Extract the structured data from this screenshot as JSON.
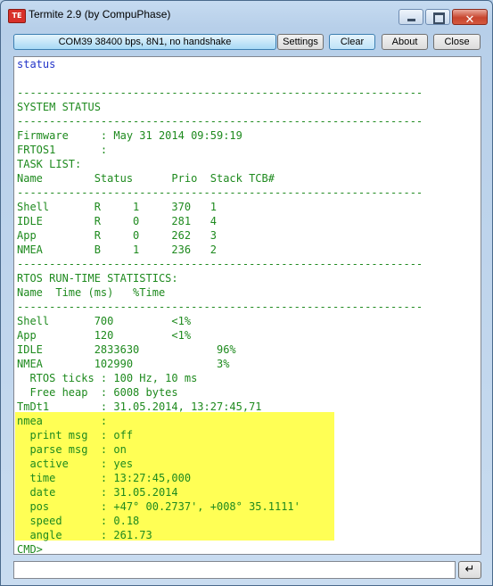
{
  "window": {
    "title": "Termite 2.9 (by CompuPhase)",
    "app_icon_text": "TE",
    "controls": {
      "minimize": "minimize",
      "maximize": "maximize",
      "close": "✕"
    }
  },
  "toolbar": {
    "connection_status": "COM39 38400 bps, 8N1, no handshake",
    "settings_label": "Settings",
    "clear_label": "Clear",
    "about_label": "About",
    "close_label": "Close"
  },
  "terminal": {
    "lines": [
      {
        "text": "status",
        "kind": "cmd"
      },
      {
        "text": "",
        "kind": "out"
      },
      {
        "text": "---------------------------------------------------------------",
        "kind": "out"
      },
      {
        "text": "SYSTEM STATUS",
        "kind": "out"
      },
      {
        "text": "---------------------------------------------------------------",
        "kind": "out"
      },
      {
        "text": "Firmware     : May 31 2014 09:59:19",
        "kind": "out"
      },
      {
        "text": "FRTOS1       :",
        "kind": "out"
      },
      {
        "text": "TASK LIST:",
        "kind": "out"
      },
      {
        "text": "Name        Status      Prio  Stack TCB#",
        "kind": "out"
      },
      {
        "text": "---------------------------------------------------------------",
        "kind": "out"
      },
      {
        "text": "Shell       R     1     370   1",
        "kind": "out"
      },
      {
        "text": "IDLE        R     0     281   4",
        "kind": "out"
      },
      {
        "text": "App         R     0     262   3",
        "kind": "out"
      },
      {
        "text": "NMEA        B     1     236   2",
        "kind": "out"
      },
      {
        "text": "---------------------------------------------------------------",
        "kind": "out"
      },
      {
        "text": "RTOS RUN-TIME STATISTICS:",
        "kind": "out"
      },
      {
        "text": "Name  Time (ms)   %Time",
        "kind": "out"
      },
      {
        "text": "---------------------------------------------------------------",
        "kind": "out"
      },
      {
        "text": "Shell       700         <1%",
        "kind": "out"
      },
      {
        "text": "App         120         <1%",
        "kind": "out"
      },
      {
        "text": "IDLE        2833630            96%",
        "kind": "out"
      },
      {
        "text": "NMEA        102990             3%",
        "kind": "out"
      },
      {
        "text": "  RTOS ticks : 100 Hz, 10 ms",
        "kind": "out"
      },
      {
        "text": "  Free heap  : 6008 bytes",
        "kind": "out"
      },
      {
        "text": "TmDt1        : 31.05.2014, 13:27:45,71",
        "kind": "out"
      },
      {
        "text": "nmea         :",
        "kind": "out"
      },
      {
        "text": "  print msg  : off",
        "kind": "out"
      },
      {
        "text": "  parse msg  : on",
        "kind": "out"
      },
      {
        "text": "  active     : yes",
        "kind": "out"
      },
      {
        "text": "  time       : 13:27:45,000",
        "kind": "out"
      },
      {
        "text": "  date       : 31.05.2014",
        "kind": "out"
      },
      {
        "text": "  pos        : +47° 00.2737', +008° 35.1111'",
        "kind": "out"
      },
      {
        "text": "  speed      : 0.18",
        "kind": "out"
      },
      {
        "text": "  angle      : 261.73",
        "kind": "out"
      },
      {
        "text": "CMD>",
        "kind": "out"
      }
    ],
    "highlight_color": "#ffff55"
  },
  "input": {
    "value": "",
    "enter_icon": "↵"
  },
  "colors": {
    "output_text": "#1e8a1e",
    "command_text": "#2233c8"
  }
}
